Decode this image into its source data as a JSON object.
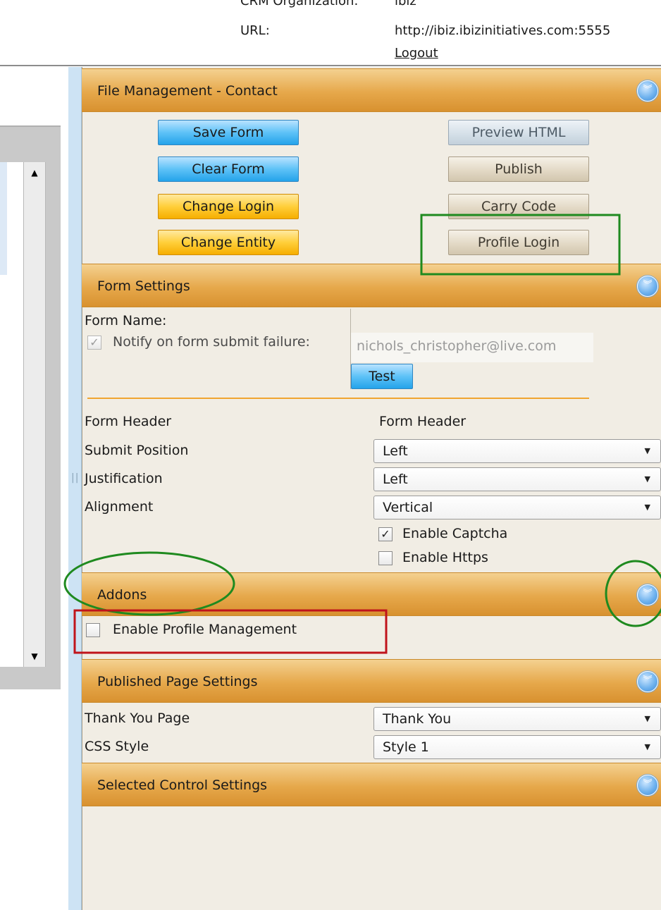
{
  "header": {
    "crm_label": "CRM Organization:",
    "crm_value": "ibiz",
    "url_label": "URL:",
    "url_value": "http://ibiz.ibizinitiatives.com:5555",
    "logout": "Logout"
  },
  "sections": {
    "file_management": "File Management - Contact",
    "form_settings": "Form Settings",
    "addons": "Addons",
    "published_page_settings": "Published Page Settings",
    "selected_control_settings": "Selected Control Settings"
  },
  "buttons": {
    "save_form": "Save Form",
    "clear_form": "Clear Form",
    "change_login": "Change Login",
    "change_entity": "Change Entity",
    "preview_html": "Preview HTML",
    "publish": "Publish",
    "carry_code": "Carry Code",
    "profile_login": "Profile Login",
    "test": "Test"
  },
  "form_settings": {
    "form_name_label": "Form Name:",
    "notify_label": "Notify on form submit failure:",
    "notify_checked": true,
    "notify_email": "nichols_christopher@live.com",
    "form_header_label": "Form Header",
    "form_header_value": "Form Header",
    "submit_position_label": "Submit Position",
    "submit_position_value": "Left",
    "justification_label": "Justification",
    "justification_value": "Left",
    "alignment_label": "Alignment",
    "alignment_value": "Vertical",
    "enable_captcha_label": "Enable Captcha",
    "enable_captcha_checked": true,
    "enable_https_label": "Enable Https",
    "enable_https_checked": false
  },
  "addons": {
    "enable_profile_label": "Enable Profile Management",
    "enable_profile_checked": false
  },
  "published": {
    "thank_you_label": "Thank You Page",
    "thank_you_value": "Thank You",
    "css_style_label": "CSS Style",
    "css_style_value": "Style 1"
  },
  "icons": {
    "section_toggle": "chevron-double-down-icon",
    "scroll_up": "triangle-up-icon",
    "scroll_down": "triangle-down-icon",
    "dropdown": "triangle-down-icon"
  },
  "colors": {
    "section_header": "#e6a84b",
    "panel_bg": "#f1ede4",
    "annotation_green": "#1f8a1f",
    "annotation_red": "#c0141b"
  }
}
